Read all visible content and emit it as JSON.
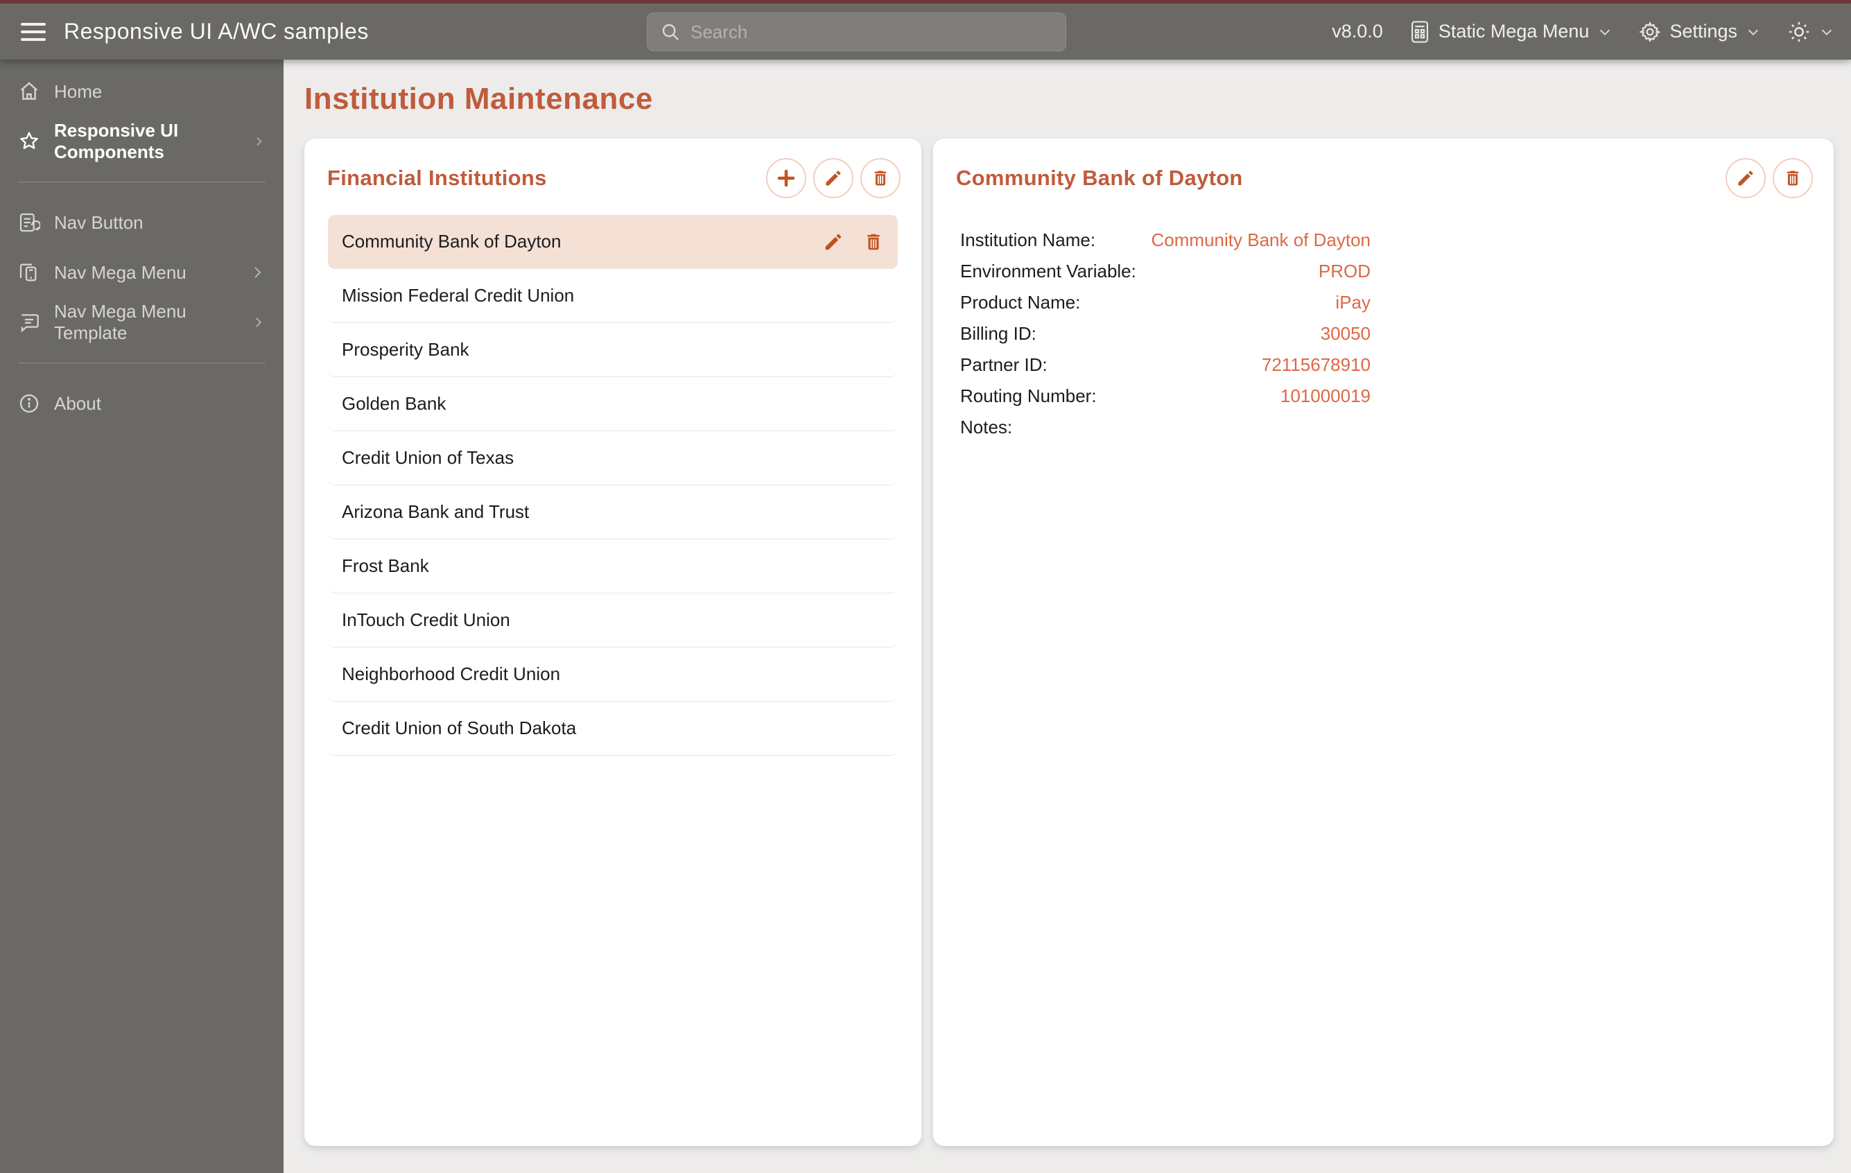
{
  "topbar": {
    "title": "Responsive UI A/WC samples",
    "search_placeholder": "Search",
    "version": "v8.0.0",
    "mega_menu_label": "Static Mega Menu",
    "settings_label": "Settings"
  },
  "sidebar": {
    "items": [
      {
        "label": "Home"
      },
      {
        "label": "Responsive UI Components"
      },
      {
        "label": "Nav Button"
      },
      {
        "label": "Nav Mega Menu"
      },
      {
        "label": "Nav Mega Menu Template"
      },
      {
        "label": "About"
      }
    ]
  },
  "page": {
    "title": "Institution Maintenance"
  },
  "institutions_panel": {
    "title": "Financial Institutions",
    "selected_index": 0,
    "items": [
      "Community Bank of Dayton",
      "Mission Federal Credit Union",
      "Prosperity Bank",
      "Golden Bank",
      "Credit Union of Texas",
      "Arizona Bank and Trust",
      "Frost Bank",
      "InTouch Credit Union",
      "Neighborhood Credit Union",
      "Credit Union of South Dakota"
    ]
  },
  "details_panel": {
    "title": "Community Bank of Dayton",
    "fields": [
      {
        "label": "Institution Name:",
        "value": "Community Bank of Dayton"
      },
      {
        "label": "Environment Variable:",
        "value": "PROD"
      },
      {
        "label": "Product Name:",
        "value": "iPay"
      },
      {
        "label": "Billing ID:",
        "value": "30050"
      },
      {
        "label": "Partner ID:",
        "value": "72115678910"
      },
      {
        "label": "Routing Number:",
        "value": "101000019"
      },
      {
        "label": "Notes:",
        "value": ""
      }
    ]
  },
  "colors": {
    "accent_heading": "#C05B3C",
    "accent_value": "#DC6945",
    "accent_icon": "#C25422",
    "selected_row_bg": "#F5E0D6",
    "chrome_gray": "#6A6966",
    "top_stripe": "#703A3D",
    "page_bg": "#EDECEB"
  }
}
